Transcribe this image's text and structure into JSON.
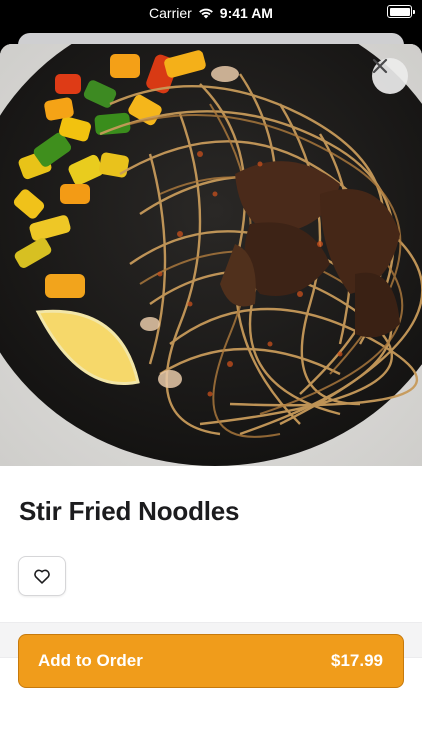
{
  "status_bar": {
    "carrier": "Carrier",
    "time": "9:41 AM"
  },
  "item": {
    "name": "Stir Fried Noodles",
    "image_icon": "food-photo-icon"
  },
  "order_button": {
    "label": "Add to Order",
    "price": "$17.99"
  },
  "colors": {
    "accent": "#f09c1b",
    "accent_border": "#c77a0c",
    "title_text": "#1c1c1e"
  }
}
